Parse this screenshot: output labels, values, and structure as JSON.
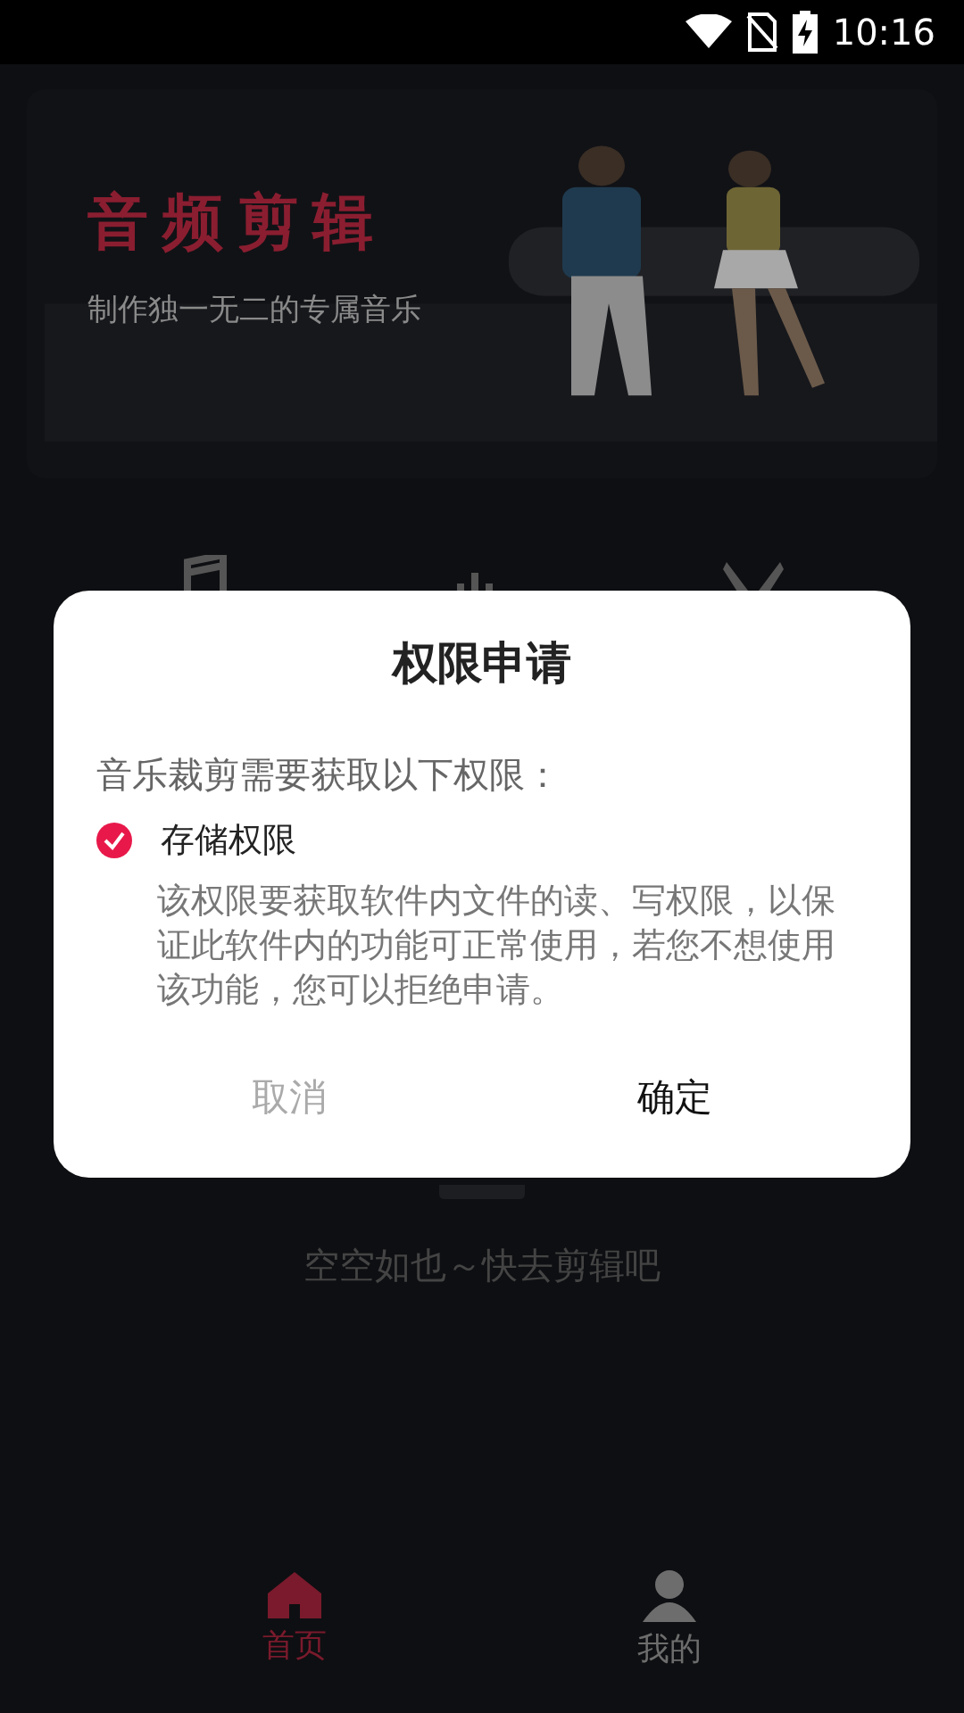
{
  "status_bar": {
    "time": "10:16"
  },
  "banner": {
    "title": "音频剪辑",
    "subtitle": "制作独一无二的专属音乐"
  },
  "tools": [
    {
      "kind": "note"
    },
    {
      "kind": "wave"
    },
    {
      "kind": "scissors"
    }
  ],
  "empty_state": {
    "text": "空空如也～快去剪辑吧"
  },
  "dialog": {
    "title": "权限申请",
    "intro": "音乐裁剪需要获取以下权限：",
    "permissions": [
      {
        "name": "存储权限",
        "checked": true,
        "description": "该权限要获取软件内文件的读、写权限，以保证此软件内的功能可正常使用，若您不想使用该功能，您可以拒绝申请。"
      }
    ],
    "buttons": [
      {
        "label": "取消",
        "kind": "cancel"
      },
      {
        "label": "确定",
        "kind": "confirm"
      }
    ]
  },
  "bottom_nav": [
    {
      "label": "首页",
      "kind": "home",
      "selected": true
    },
    {
      "label": "我的",
      "kind": "profile",
      "selected": false
    }
  ]
}
